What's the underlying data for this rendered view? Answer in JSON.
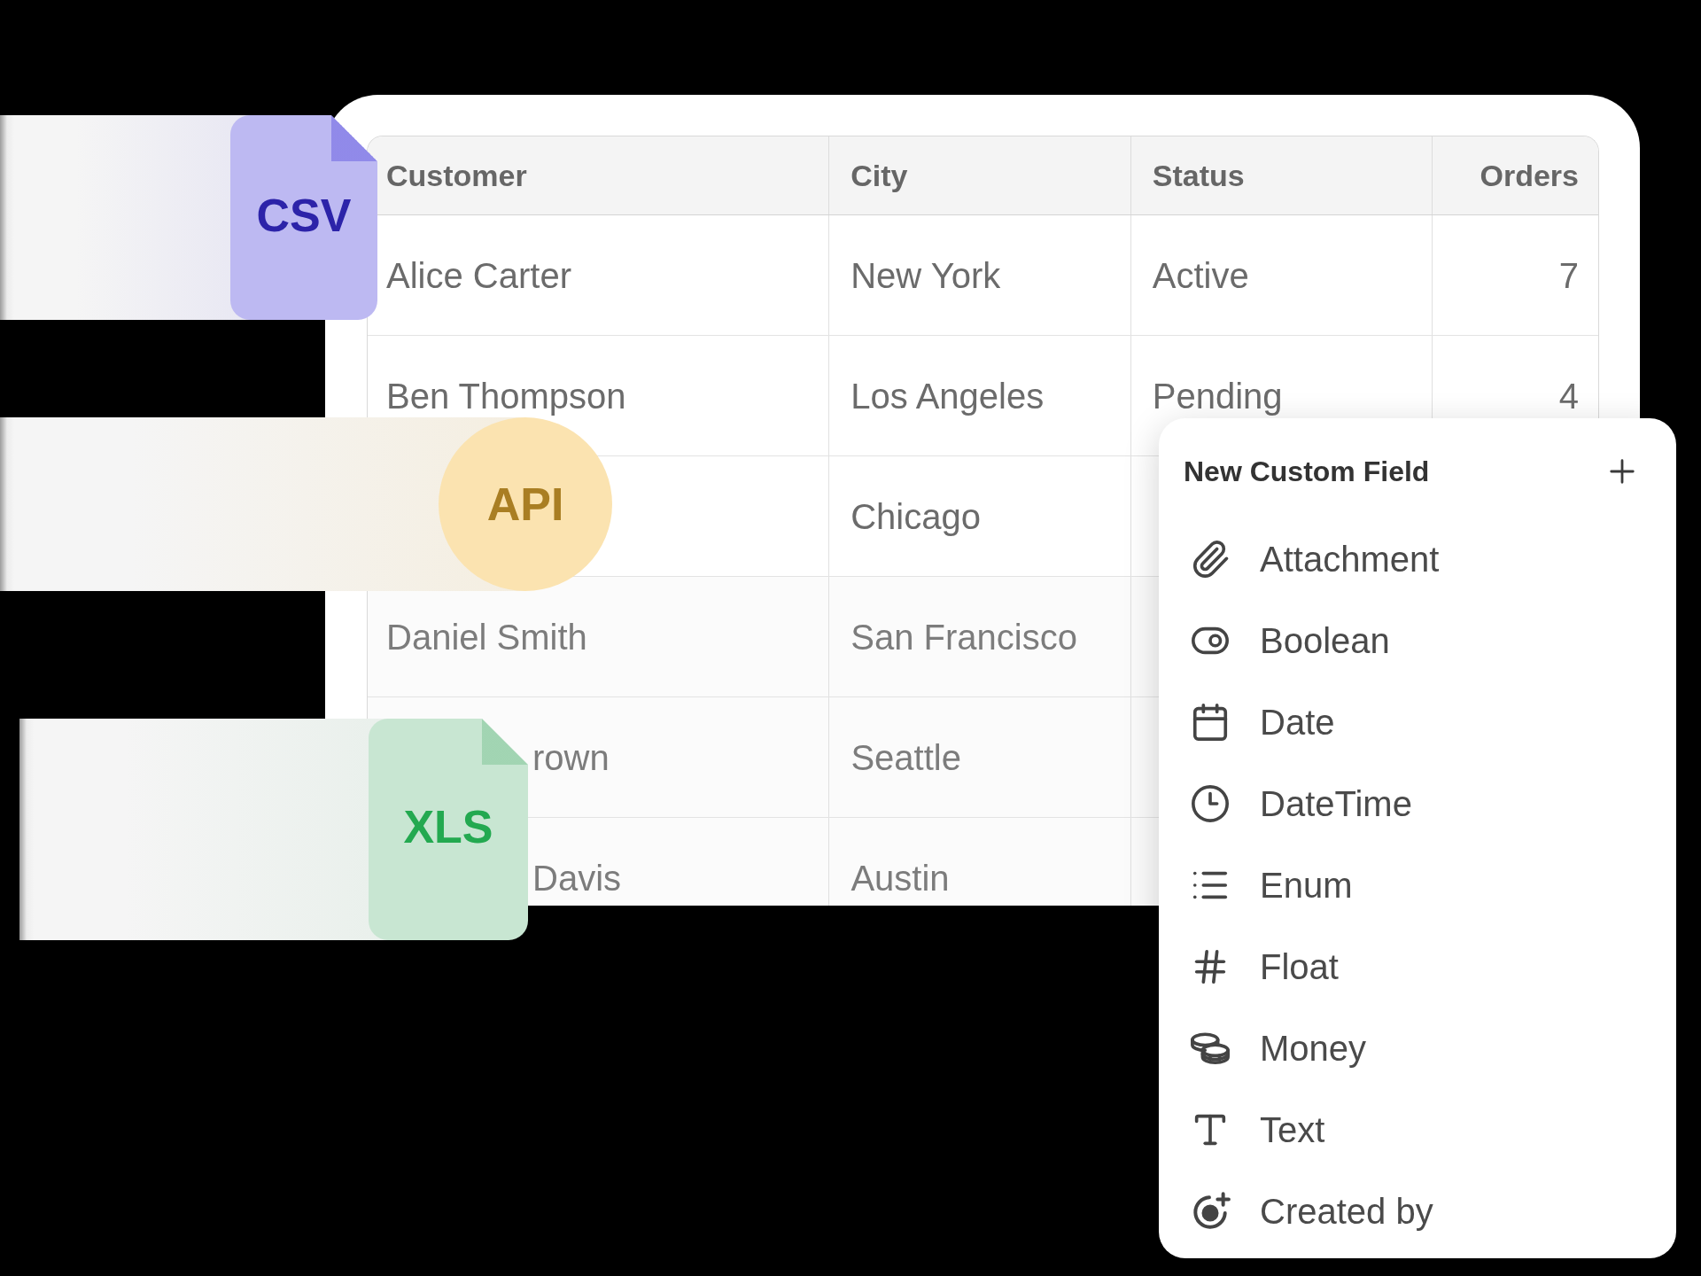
{
  "sources": [
    {
      "kind": "file",
      "label": "CSV",
      "color": "#bdb9f2"
    },
    {
      "kind": "circle",
      "label": "API",
      "color": "#fbe3b0"
    },
    {
      "kind": "file",
      "label": "XLS",
      "color": "#c8e6d2"
    }
  ],
  "table": {
    "columns": [
      {
        "label": "Customer",
        "kind": "text"
      },
      {
        "label": "City",
        "kind": "text"
      },
      {
        "label": "Status",
        "kind": "text"
      },
      {
        "label": "Orders",
        "kind": "number"
      }
    ],
    "rows": [
      {
        "customer": "Alice Carter",
        "city": "New York",
        "status": "Active",
        "orders": "7"
      },
      {
        "customer": "Ben Thompson",
        "city": "Los Angeles",
        "status": "Pending",
        "orders": "4"
      },
      {
        "city": "Chicago"
      },
      {
        "customer": "Daniel Smith",
        "city": "San Francisco"
      },
      {
        "customer": "rown",
        "city": "Seattle"
      },
      {
        "customer": "Davis",
        "city": "Austin"
      }
    ]
  },
  "custom_field_menu": {
    "title": "New Custom Field",
    "items": [
      {
        "label": "Attachment"
      },
      {
        "label": "Boolean"
      },
      {
        "label": "Date"
      },
      {
        "label": "DateTime"
      },
      {
        "label": "Enum"
      },
      {
        "label": "Float"
      },
      {
        "label": "Money"
      },
      {
        "label": "Text"
      },
      {
        "label": "Created by"
      }
    ]
  }
}
